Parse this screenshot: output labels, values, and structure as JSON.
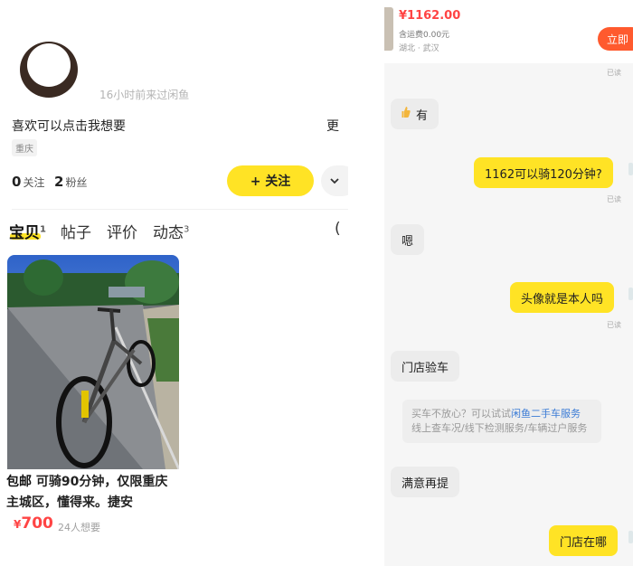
{
  "profile": {
    "last_seen": "16小时前来过闲鱼",
    "bio": "喜欢可以点击我想要",
    "more_label": "更",
    "city": "重庆",
    "following_count": "0",
    "following_label": "关注",
    "followers_count": "2",
    "followers_label": "粉丝",
    "follow_button": "+ 关注",
    "menu_icon": "chevron-down-icon"
  },
  "tabs": [
    {
      "label": "宝贝",
      "badge": "1"
    },
    {
      "label": "帖子",
      "badge": ""
    },
    {
      "label": "评价",
      "badge": ""
    },
    {
      "label": "动态",
      "badge": "3"
    }
  ],
  "tab_cut_char": "(",
  "listing": {
    "tag": "包邮",
    "title": "可骑90分钟，仅限重庆主城区，懂得来。捷安",
    "currency": "¥",
    "price": "700",
    "wants": "24人想要"
  },
  "chat": {
    "product": {
      "price": "¥1162.00",
      "shipping": "含运费0.00元",
      "location": "湖北 · 武汉",
      "buy_button": "立即"
    },
    "read_label": "已读",
    "messages": [
      {
        "side": "in",
        "icon": "thumbs-up-icon",
        "text": "有"
      },
      {
        "side": "out",
        "text": "1162可以骑120分钟?"
      },
      {
        "side": "in",
        "text": "嗯"
      },
      {
        "side": "out",
        "text": "头像就是本人吗"
      },
      {
        "side": "in",
        "text": "门店验车"
      },
      {
        "side": "in",
        "text": "满意再提"
      },
      {
        "side": "out",
        "text": "门店在哪"
      }
    ],
    "system_tip": {
      "line1_prefix": "买车不放心？可以试试",
      "line1_link": "闲鱼二手车服务",
      "line2": "线上查车况/线下检测服务/车辆过户服务"
    }
  },
  "colors": {
    "accent_yellow": "#ffe325",
    "price_red": "#ff4444",
    "buy_orange": "#ff5a2e",
    "link_blue": "#3a7bd5"
  }
}
